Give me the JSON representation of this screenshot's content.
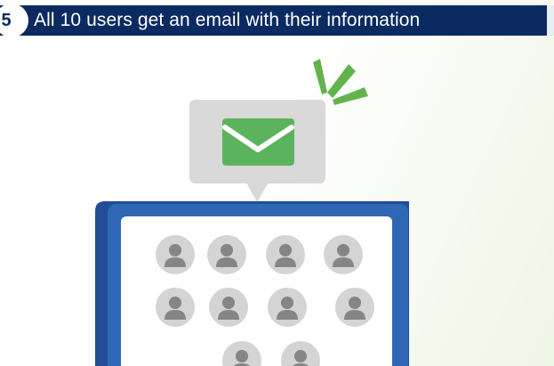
{
  "step": {
    "number": "5",
    "title": "All 10 users get an email with their information"
  },
  "illustration": {
    "envelope_icon": "email-envelope-icon",
    "user_icon": "user-avatar-icon",
    "user_count": 10,
    "colors": {
      "header_bg": "#0b2a62",
      "bubble_bg": "#d9d9d9",
      "envelope_green": "#5cb35d",
      "burst_green": "#63b34d",
      "device_blue": "#2f67b6",
      "avatar_circle": "#d4d4d4",
      "avatar_person": "#858585"
    }
  }
}
